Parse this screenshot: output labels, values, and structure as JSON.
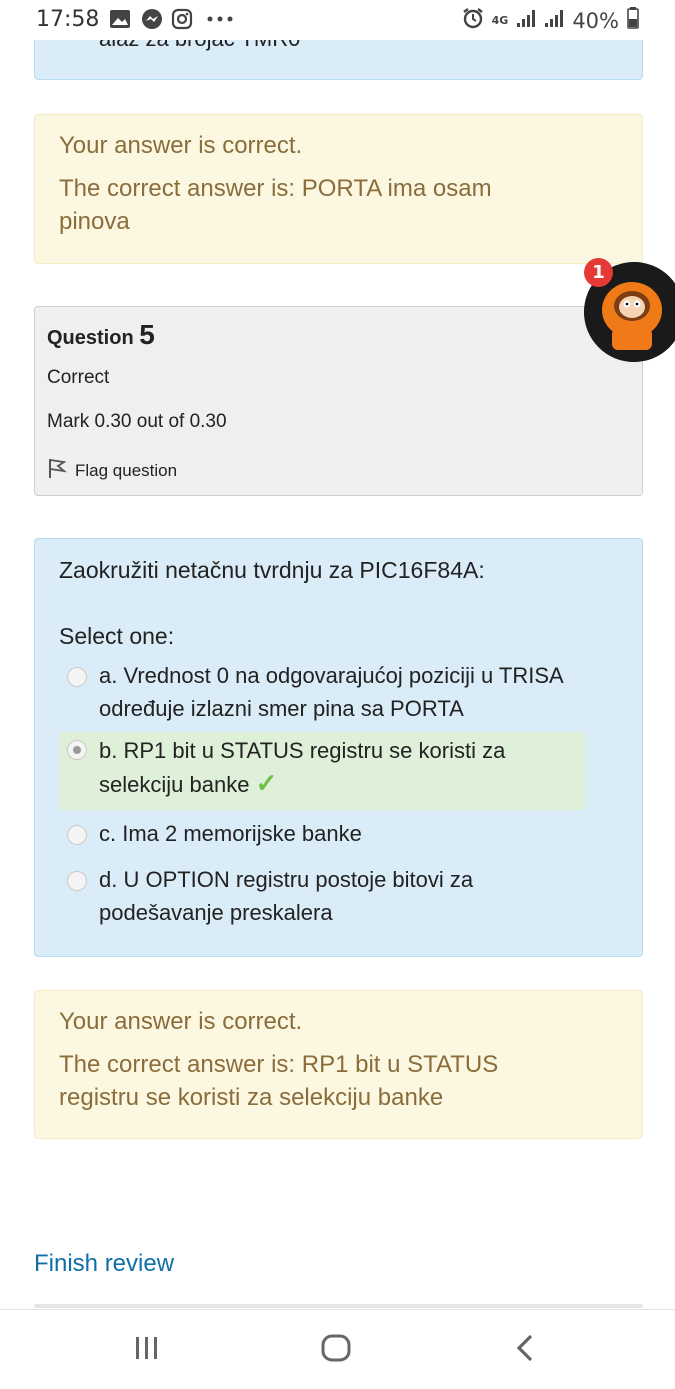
{
  "status_bar": {
    "time": "17:58",
    "network": "4G",
    "battery": "40%",
    "left_icons": [
      "gallery-icon",
      "messenger-icon",
      "instagram-icon",
      "more-icon"
    ],
    "right_icons": [
      "alarm-icon",
      "signal-icon",
      "signal-icon",
      "battery-icon"
    ]
  },
  "prev_question": {
    "cut_text": "alaz za brojac TMR0",
    "feedback_correct": "Your answer is correct.",
    "feedback_answer": "The correct answer is: PORTA ima osam pinova"
  },
  "question": {
    "title_prefix": "Question",
    "number": "5",
    "state": "Correct",
    "mark": "Mark 0.30 out of 0.30",
    "flag_label": "Flag question",
    "prompt": "Zaokružiti netačnu tvrdnju za PIC16F84A:",
    "select_label": "Select one:",
    "options": [
      {
        "label": "a. Vrednost 0 na odgovarajućoj poziciji u TRISA određuje izlazni smer pina sa PORTA",
        "selected": false
      },
      {
        "label": "b. RP1 bit u STATUS registru se koristi za selekciju banke",
        "selected": true
      },
      {
        "label": "c. Ima 2 memorijske banke",
        "selected": false
      },
      {
        "label": "d. U OPTION registru postoje bitovi za podešavanje preskalera",
        "selected": false
      }
    ],
    "correct_mark": "✓",
    "feedback_correct": "Your answer is correct.",
    "feedback_answer": "The correct answer is: RP1 bit u STATUS registru se koristi za selekciju banke"
  },
  "finish_review": "Finish review",
  "chat_head": {
    "badge_count": "1"
  },
  "nav": {
    "recent": "recent-apps-icon",
    "home": "home-icon",
    "back": "back-icon"
  },
  "colors": {
    "info_bg": "#d9ecf8",
    "feedback_bg": "#fcf7e1",
    "feedback_text": "#8a6d3b",
    "link": "#0f6fa8",
    "correct_bg": "#dff0d8"
  }
}
